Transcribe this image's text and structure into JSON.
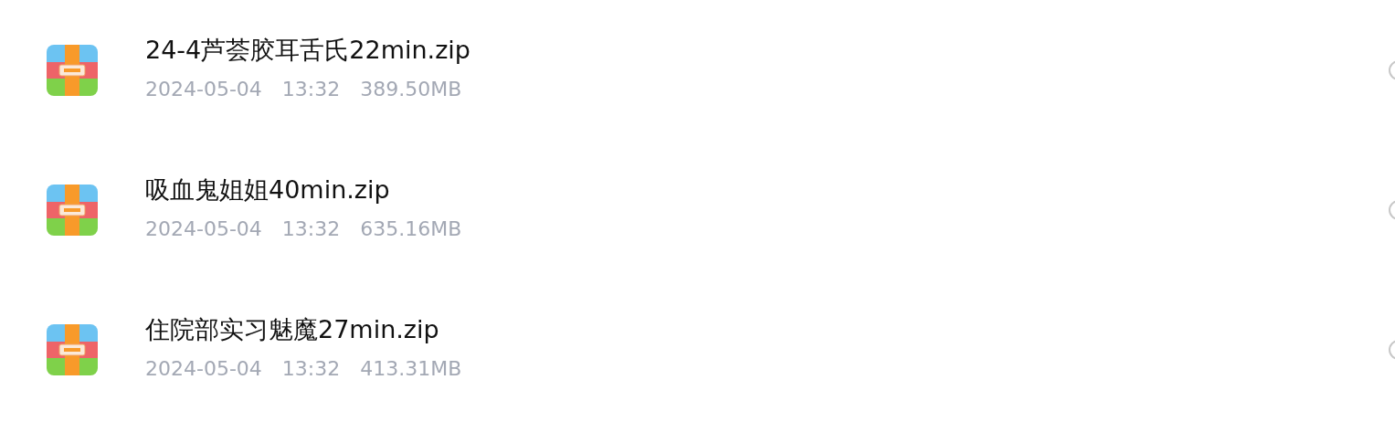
{
  "files": [
    {
      "name": "24-4芦荟胶耳舌氏22min.zip",
      "date": "2024-05-04",
      "time": "13:32",
      "size": "389.50MB",
      "selected": false
    },
    {
      "name": "吸血鬼姐姐40min.zip",
      "date": "2024-05-04",
      "time": "13:32",
      "size": "635.16MB",
      "selected": false
    },
    {
      "name": "住院部实习魅魔27min.zip",
      "date": "2024-05-04",
      "time": "13:32",
      "size": "413.31MB",
      "selected": false
    }
  ]
}
